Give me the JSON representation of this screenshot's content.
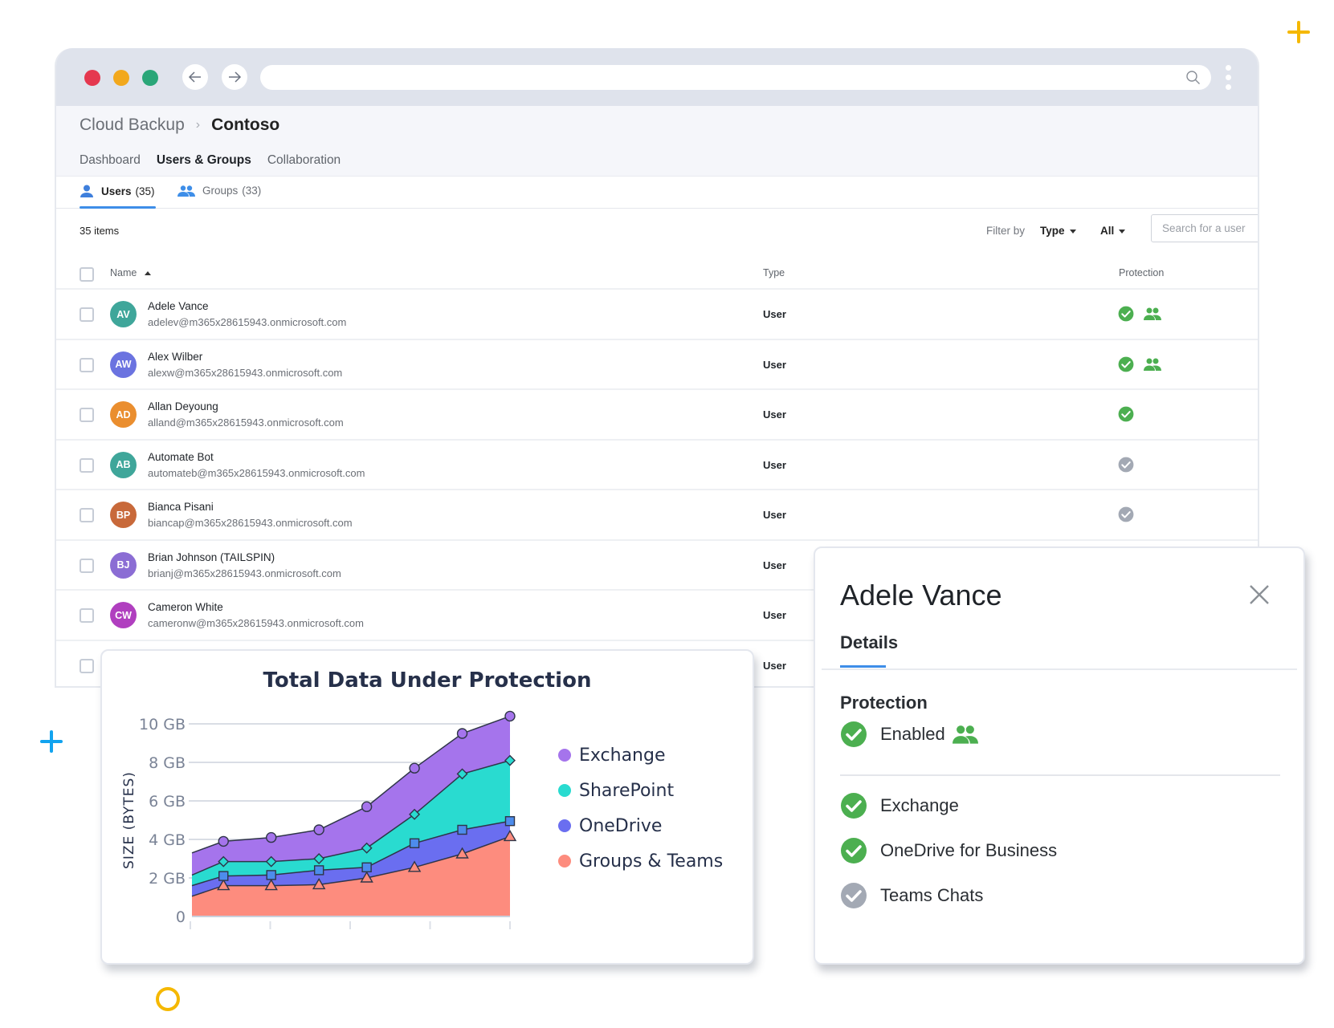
{
  "browser": {
    "back_label": "Back",
    "forward_label": "Forward",
    "address": ""
  },
  "app": {
    "breadcrumb": {
      "root": "Cloud Backup",
      "current": "Contoso"
    },
    "main_tabs": [
      {
        "label": "Dashboard",
        "active": false
      },
      {
        "label": "Users & Groups",
        "active": true
      },
      {
        "label": "Collaboration",
        "active": false
      }
    ],
    "sub_tabs": {
      "users": {
        "label": "Users",
        "count": "(35)"
      },
      "groups": {
        "label": "Groups",
        "count": "(33)"
      }
    },
    "toolbar": {
      "item_count": "35 items",
      "filter_label": "Filter by",
      "type_dropdown": "Type",
      "all_dropdown": "All",
      "search_placeholder": "Search for a user"
    },
    "table": {
      "columns": {
        "name": "Name",
        "type": "Type",
        "protection": "Protection"
      },
      "rows": [
        {
          "initials": "AV",
          "color": "#3fa69a",
          "name": "Adele Vance",
          "email": "adelev@m365x28615943.onmicrosoft.com",
          "type": "User",
          "protection": "enabled",
          "group_protected": true
        },
        {
          "initials": "AW",
          "color": "#6b73e0",
          "name": "Alex Wilber",
          "email": "alexw@m365x28615943.onmicrosoft.com",
          "type": "User",
          "protection": "enabled",
          "group_protected": true
        },
        {
          "initials": "AD",
          "color": "#ea8e2f",
          "name": "Allan Deyoung",
          "email": "alland@m365x28615943.onmicrosoft.com",
          "type": "User",
          "protection": "enabled",
          "group_protected": false
        },
        {
          "initials": "AB",
          "color": "#3fa69a",
          "name": "Automate Bot",
          "email": "automateb@m365x28615943.onmicrosoft.com",
          "type": "User",
          "protection": "disabled",
          "group_protected": false
        },
        {
          "initials": "BP",
          "color": "#c8693a",
          "name": "Bianca Pisani",
          "email": "biancap@m365x28615943.onmicrosoft.com",
          "type": "User",
          "protection": "disabled",
          "group_protected": false
        },
        {
          "initials": "BJ",
          "color": "#8b6dd4",
          "name": "Brian Johnson (TAILSPIN)",
          "email": "brianj@m365x28615943.onmicrosoft.com",
          "type": "User",
          "protection": "",
          "group_protected": false
        },
        {
          "initials": "CW",
          "color": "#b03fbf",
          "name": "Cameron White",
          "email": "cameronw@m365x28615943.onmicrosoft.com",
          "type": "User",
          "protection": "",
          "group_protected": false
        },
        {
          "initials": "",
          "color": "#a33fbf",
          "name": "",
          "email": "",
          "type": "User",
          "protection": "",
          "group_protected": false
        }
      ]
    }
  },
  "details": {
    "title": "Adele Vance",
    "tab": "Details",
    "section": "Protection",
    "status": "Enabled",
    "services": [
      {
        "label": "Exchange",
        "enabled": true
      },
      {
        "label": "OneDrive for Business",
        "enabled": true
      },
      {
        "label": "Teams Chats",
        "enabled": false
      }
    ]
  },
  "colors": {
    "accent": "#3e8ee8",
    "ok": "#4caf50",
    "disabled": "#a3a9b4",
    "deco_yellow": "#f5b800",
    "deco_blue": "#12a3ef"
  },
  "chart_data": {
    "type": "area",
    "stacked": true,
    "title": "Total Data Under Protection",
    "xlabel": "",
    "ylabel": "SIZE (BYTES)",
    "ylim": [
      0,
      10
    ],
    "yticks": [
      "0",
      "2 GB",
      "4 GB",
      "6 GB",
      "8 GB",
      "10 GB"
    ],
    "ytick_values": [
      0,
      2,
      4,
      6,
      8,
      10
    ],
    "grid": true,
    "legend_position": "right",
    "x": [
      0,
      1,
      2,
      3,
      4,
      5,
      6,
      7
    ],
    "markers_from_index": 1,
    "series": [
      {
        "name": "Groups & Teams",
        "color": "#fd8c7e",
        "marker": "triangle",
        "cumulative": [
          1.05,
          1.6,
          1.6,
          1.65,
          2.0,
          2.55,
          3.25,
          4.15
        ]
      },
      {
        "name": "OneDrive",
        "color": "#6a6ef0",
        "marker": "square",
        "cumulative": [
          1.6,
          2.1,
          2.15,
          2.4,
          2.55,
          3.8,
          4.5,
          4.95
        ]
      },
      {
        "name": "SharePoint",
        "color": "#29dbd0",
        "marker": "diamond",
        "cumulative": [
          2.15,
          2.85,
          2.85,
          3.0,
          3.55,
          5.3,
          7.4,
          8.1
        ]
      },
      {
        "name": "Exchange",
        "color": "#a574ec",
        "marker": "circle",
        "cumulative": [
          3.3,
          3.9,
          4.1,
          4.5,
          5.7,
          7.7,
          9.5,
          10.4
        ]
      }
    ],
    "legend": [
      "Exchange",
      "SharePoint",
      "OneDrive",
      "Groups & Teams"
    ]
  }
}
